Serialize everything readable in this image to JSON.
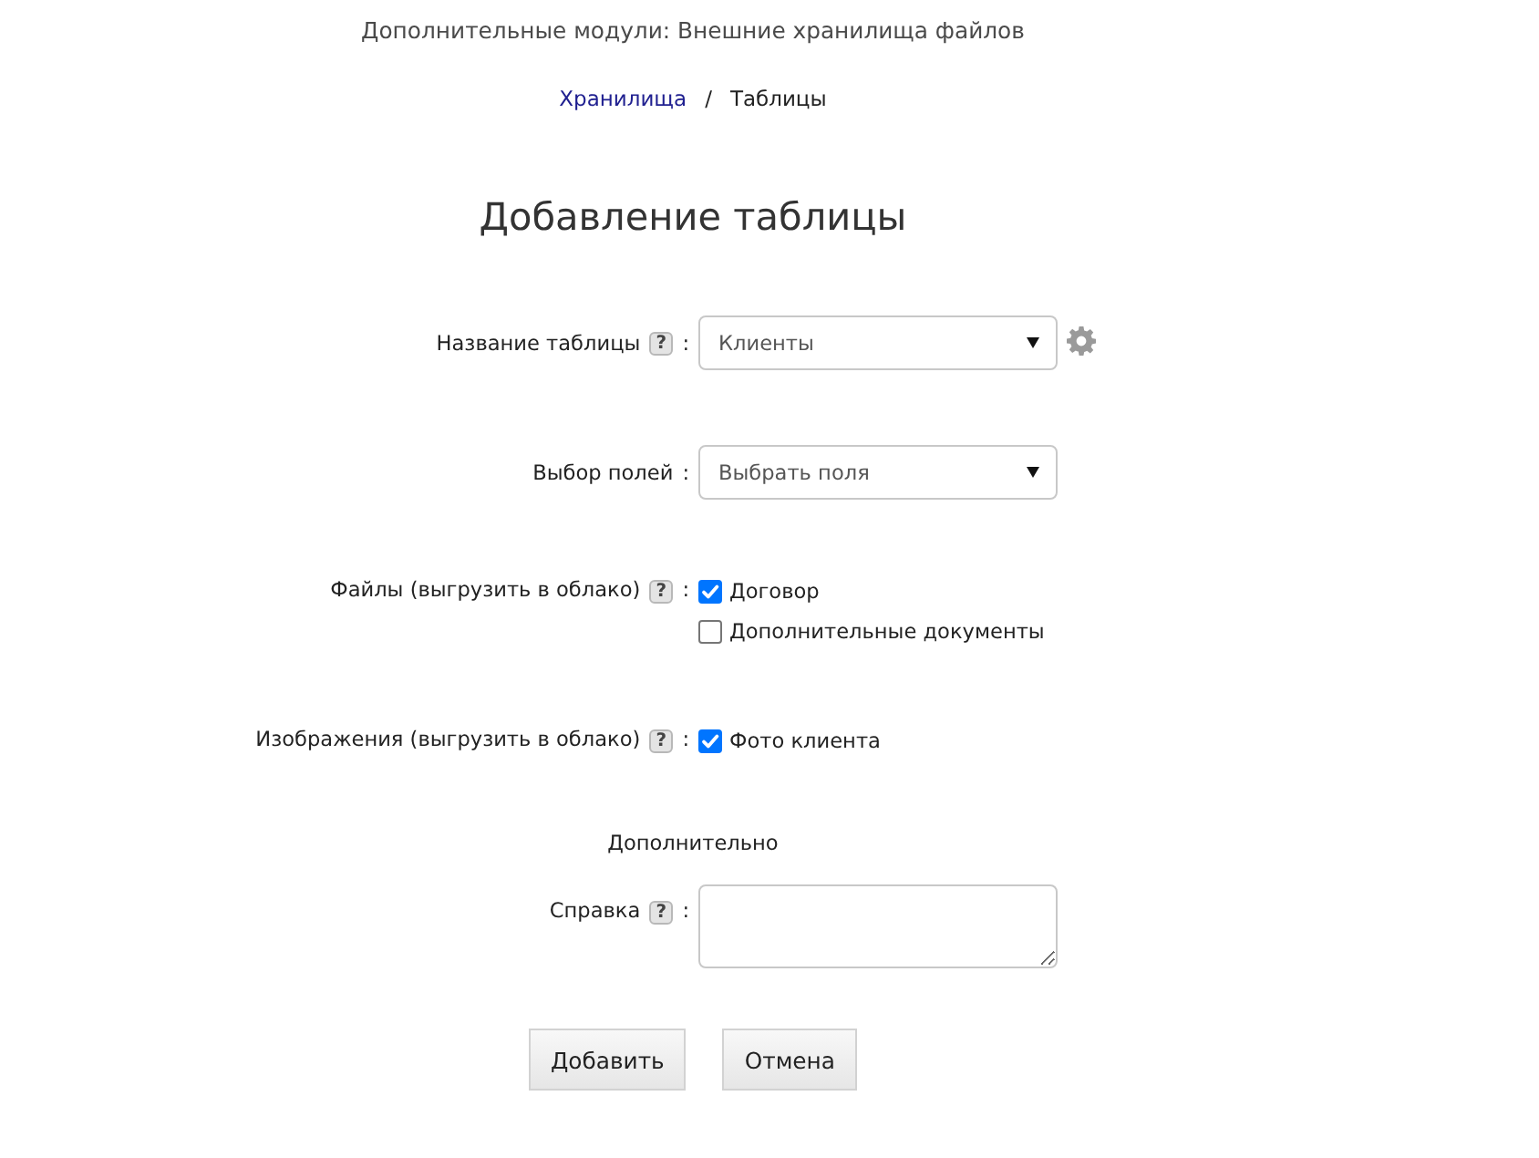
{
  "module_title": "Дополнительные модули: Внешние хранилища файлов",
  "breadcrumb": [
    {
      "label": "Хранилища",
      "kind": "link"
    },
    {
      "label": "Таблицы",
      "kind": "current"
    }
  ],
  "breadcrumb_separator": "/",
  "page_title": "Добавление таблицы",
  "label_separator": ":",
  "fields": [
    {
      "kind": "select",
      "label": "Название таблицы",
      "help": "?",
      "value": "Клиенты",
      "settings": true
    },
    {
      "kind": "select",
      "label": "Выбор полей",
      "value": "Выбрать поля"
    },
    {
      "kind": "checkboxes",
      "label": "Файлы (выгрузить в облако)",
      "help": "?",
      "options": [
        {
          "label": "Договор",
          "checked": true
        },
        {
          "label": "Дополнительные документы",
          "checked": false
        }
      ]
    },
    {
      "kind": "checkboxes",
      "label": "Изображения (выгрузить в облако)",
      "help": "?",
      "options": [
        {
          "label": "Фото клиента",
          "checked": true
        }
      ]
    },
    {
      "kind": "section",
      "label": "Дополнительно"
    },
    {
      "kind": "textarea",
      "label": "Справка",
      "help": "?"
    }
  ],
  "buttons": [
    {
      "label": "Добавить"
    },
    {
      "label": "Отмена"
    }
  ]
}
